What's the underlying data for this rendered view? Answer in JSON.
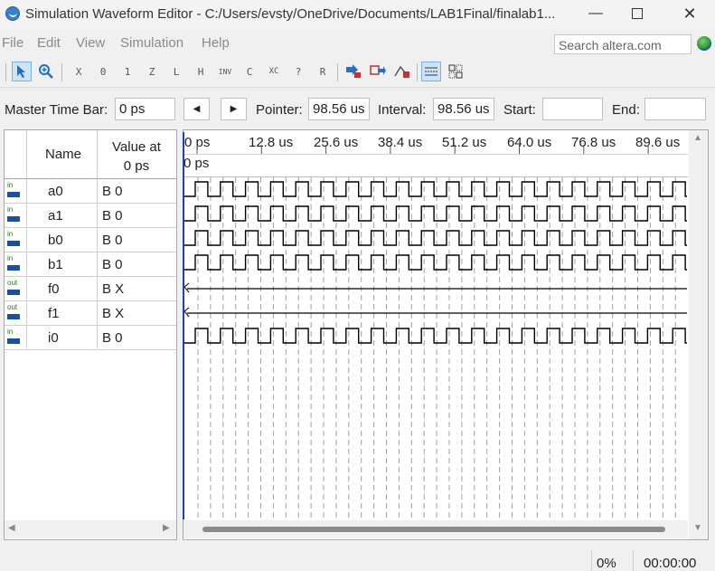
{
  "window": {
    "title": "Simulation Waveform Editor - C:/Users/evsty/OneDrive/Documents/LAB1Final/finalab1..."
  },
  "menu": {
    "items": [
      "File",
      "Edit",
      "View",
      "Simulation",
      "Help"
    ],
    "search_placeholder": "Search altera.com"
  },
  "toolbar": {
    "icons": [
      "selection-tool-icon",
      "zoom-tool-icon",
      "forcing-unknown-icon",
      "forcing-low-icon",
      "forcing-high-icon",
      "forcing-high-impedance-icon",
      "forcing-weak-low-icon",
      "forcing-weak-high-icon",
      "inverting-icon",
      "count-value-icon",
      "clock-icon",
      "arbitrary-value-icon",
      "random-values-icon",
      "run-functional-simulation-icon",
      "run-timing-simulation-icon",
      "generate-netlist-icon",
      "snap-to-grid-icon",
      "grid-icon"
    ],
    "labels": [
      "X",
      "0",
      "1",
      "Z",
      "L",
      "H",
      "INV",
      "C",
      "XC",
      "?",
      "R"
    ]
  },
  "timebar": {
    "master_label": "Master Time Bar:",
    "master_value": "0 ps",
    "pointer_label": "Pointer:",
    "pointer_value": "98.56 us",
    "interval_label": "Interval:",
    "interval_value": "98.56 us",
    "start_label": "Start:",
    "start_value": "",
    "end_label": "End:",
    "end_value": ""
  },
  "signal_table": {
    "col_name": "Name",
    "col_value_line1": "Value at",
    "col_value_line2": "0 ps",
    "rows": [
      {
        "dir": "in",
        "name": "a0",
        "value": "B 0"
      },
      {
        "dir": "in",
        "name": "a1",
        "value": "B 0"
      },
      {
        "dir": "in",
        "name": "b0",
        "value": "B 0"
      },
      {
        "dir": "in",
        "name": "b1",
        "value": "B 0"
      },
      {
        "dir": "out",
        "name": "f0",
        "value": "B X"
      },
      {
        "dir": "out",
        "name": "f1",
        "value": "B X"
      },
      {
        "dir": "in",
        "name": "i0",
        "value": "B 0"
      }
    ]
  },
  "waveform": {
    "time_ticks": [
      "0 ps",
      "12.8 us",
      "25.6 us",
      "38.4 us",
      "51.2 us",
      "64.0 us",
      "76.8 us",
      "89.6 us"
    ],
    "cursor_label": "0 ps"
  },
  "status": {
    "progress": "0%",
    "elapsed": "00:00:00"
  },
  "colors": {
    "cursor": "#1f3fbf",
    "pin_in": "#1a7a1a",
    "pin_arrow": "#1c4f9c"
  }
}
